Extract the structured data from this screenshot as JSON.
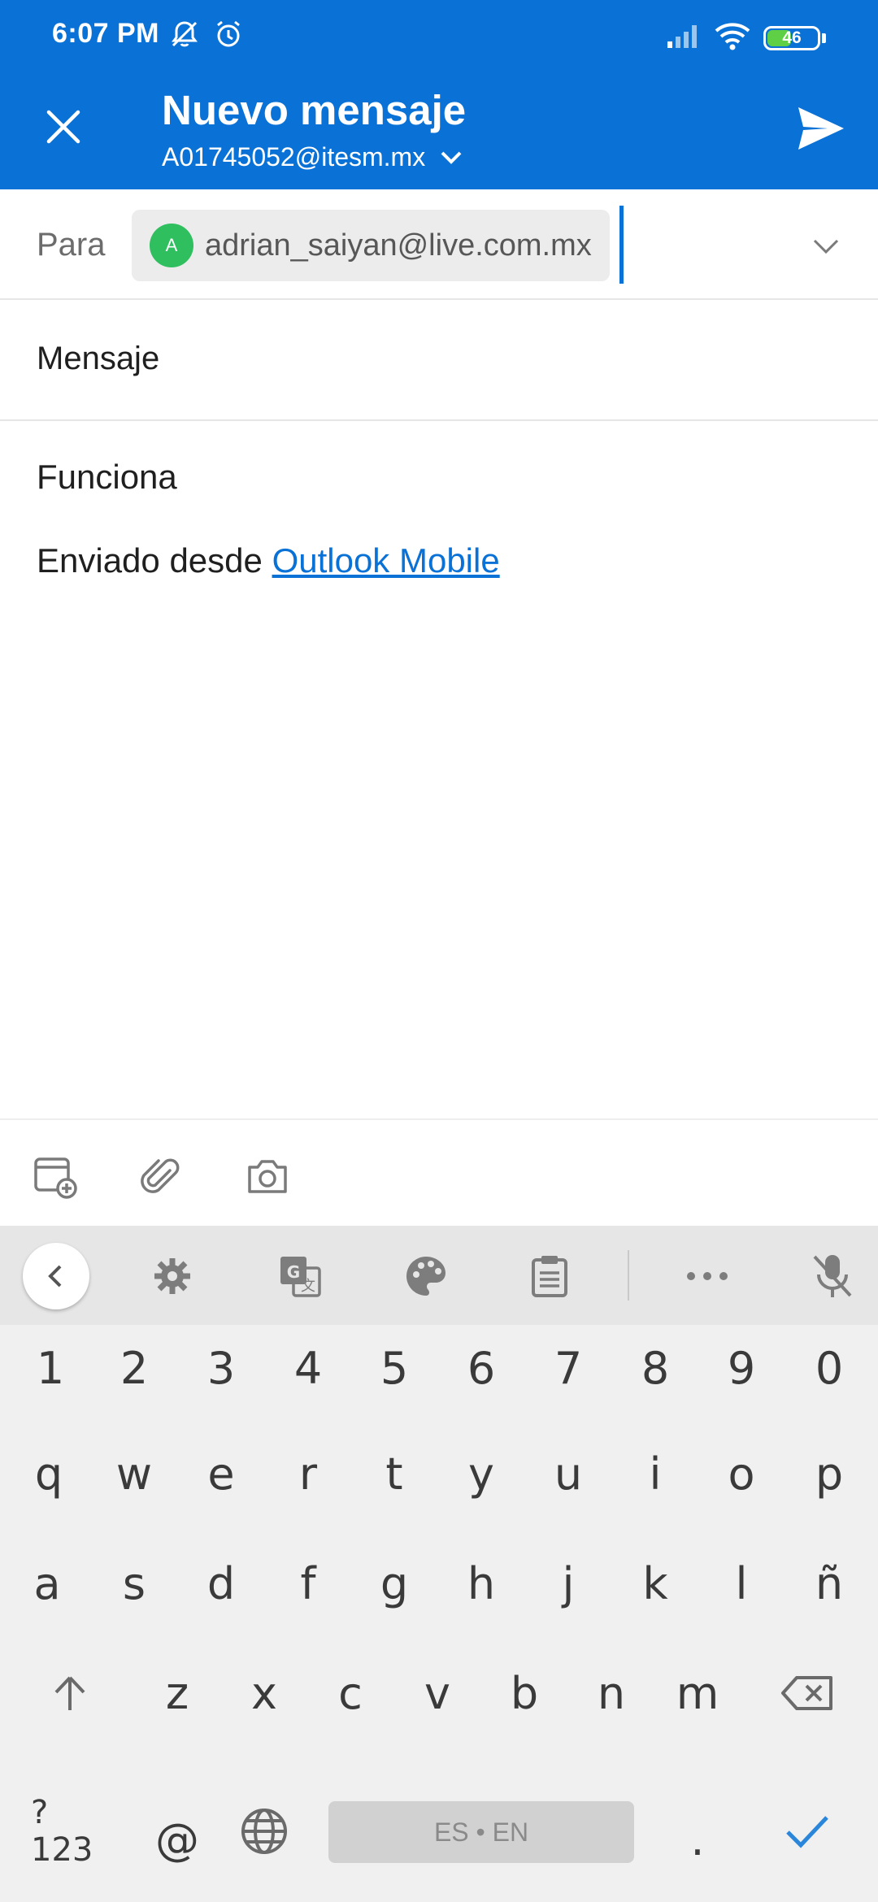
{
  "status_bar": {
    "time": "6:07 PM",
    "battery_level": "46",
    "icons": [
      "notifications-off-icon",
      "alarm-icon",
      "signal-icon",
      "wifi-icon",
      "battery-icon"
    ]
  },
  "header": {
    "title": "Nuevo mensaje",
    "account": "A01745052@itesm.mx",
    "close_icon": "close-icon",
    "send_icon": "send-icon",
    "background_color": "#0a72d6"
  },
  "to_field": {
    "label": "Para",
    "recipients": [
      {
        "avatar_initial": "A",
        "email": "adrian_saiyan@live.com.mx",
        "avatar_color": "#2fbf5f"
      }
    ]
  },
  "subject": {
    "placeholder": "Mensaje"
  },
  "body": {
    "text": "Funciona",
    "signature_prefix": "Enviado desde ",
    "signature_link": "Outlook Mobile"
  },
  "compose_toolbar": {
    "items": [
      "calendar-add-icon",
      "attachment-icon",
      "camera-icon"
    ]
  },
  "keyboard": {
    "toolbar": [
      "back-icon",
      "settings-icon",
      "translate-icon",
      "palette-icon",
      "clipboard-icon",
      "more-icon",
      "mic-off-icon"
    ],
    "rows": [
      [
        "1",
        "2",
        "3",
        "4",
        "5",
        "6",
        "7",
        "8",
        "9",
        "0"
      ],
      [
        "q",
        "w",
        "e",
        "r",
        "t",
        "y",
        "u",
        "i",
        "o",
        "p"
      ],
      [
        "a",
        "s",
        "d",
        "f",
        "g",
        "h",
        "j",
        "k",
        "l",
        "ñ"
      ]
    ],
    "row4_letters": [
      "z",
      "x",
      "c",
      "v",
      "b",
      "n",
      "m"
    ],
    "symbols_key": "?123",
    "at_key": "@",
    "space_label": "ES • EN",
    "period_key": "."
  }
}
